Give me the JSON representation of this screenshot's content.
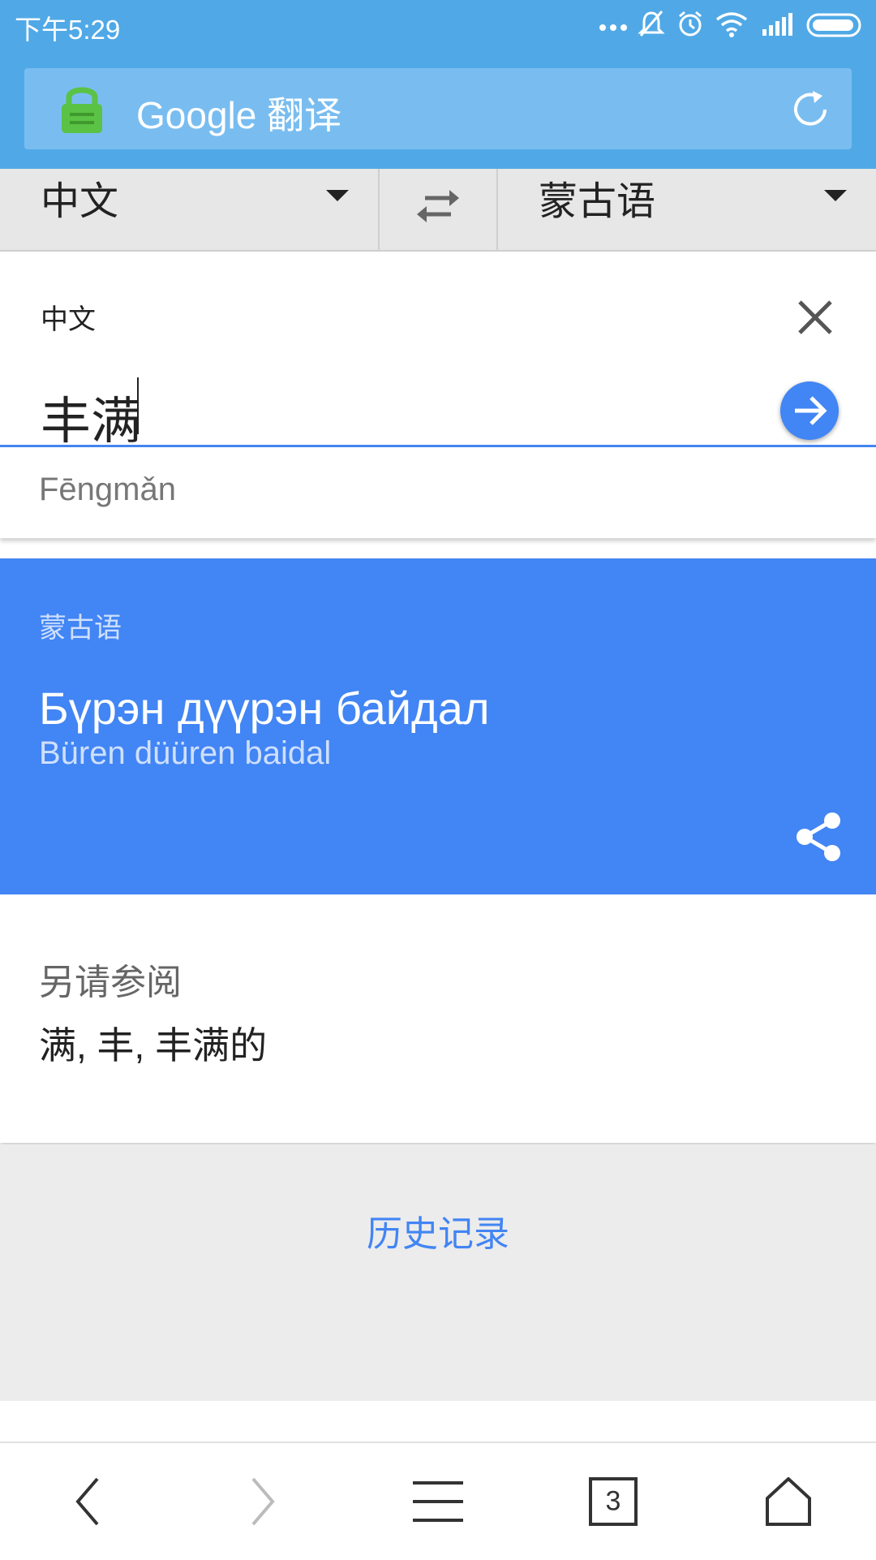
{
  "status_bar": {
    "time": "下午5:29"
  },
  "browser": {
    "title": "Google 翻译"
  },
  "language_bar": {
    "source": "中文",
    "target": "蒙古语"
  },
  "input": {
    "source_label": "中文",
    "text": "丰满",
    "pinyin": "Fēngmǎn"
  },
  "result": {
    "target_label": "蒙古语",
    "translation": "Бүрэн дүүрэн байдал",
    "transliteration": "Büren düüren baidal"
  },
  "see_also": {
    "title": "另请参阅",
    "items": "满, 丰, 丰满的"
  },
  "history": {
    "label": "历史记录"
  },
  "bottom_nav": {
    "tab_count": "3"
  },
  "colors": {
    "bar": "#50a9e6",
    "accent": "#4285f4",
    "lock": "#5ac245"
  }
}
